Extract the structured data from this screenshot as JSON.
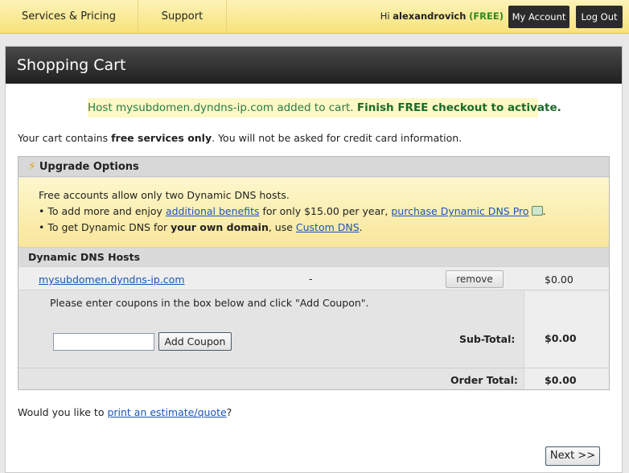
{
  "nav": {
    "services_label": "Services & Pricing",
    "support_label": "Support",
    "greeting_prefix": "Hi ",
    "username": "alexandrovich",
    "plan_badge": "(FREE)",
    "my_account_label": "My Account",
    "logout_label": "Log Out"
  },
  "page": {
    "title": "Shopping Cart"
  },
  "notice": {
    "text": "Host mysubdomen.dyndns-ip.com added to cart. ",
    "cta": "Finish FREE checkout to activate."
  },
  "cart_info": {
    "prefix": "Your cart contains ",
    "bold": "free services only",
    "suffix": ". You will not be asked for credit card information."
  },
  "upgrade": {
    "header": "Upgrade Options",
    "line1": "Free accounts allow only two Dynamic DNS hosts.",
    "line2_prefix": "• To add more and enjoy ",
    "line2_link1": "additional benefits",
    "line2_mid": " for only $15.00 per year, ",
    "line2_link2": "purchase Dynamic DNS Pro",
    "line2_suffix": ".",
    "line3_prefix": "• To get Dynamic DNS for ",
    "line3_bold": "your own domain",
    "line3_mid": ", use ",
    "line3_link": "Custom DNS",
    "line3_suffix": "."
  },
  "hosts": {
    "header": "Dynamic DNS Hosts",
    "items": [
      {
        "host": "mysubdomen.dyndns-ip.com",
        "detail": "-",
        "remove_label": "remove",
        "price": "$0.00"
      }
    ]
  },
  "coupon": {
    "message": "Please enter coupons in the box below and click \"Add Coupon\".",
    "input_value": "",
    "button_label": "Add Coupon"
  },
  "totals": {
    "subtotal_label": "Sub-Total:",
    "subtotal_value": "$0.00",
    "order_total_label": "Order Total:",
    "order_total_value": "$0.00"
  },
  "quote": {
    "prefix": "Would you like to ",
    "link": "print an estimate/quote",
    "suffix": "?"
  },
  "next_label": "Next >>",
  "colors": {
    "nav_bg": "#f7e27a",
    "title_bg": "#2b2b2b",
    "free_badge": "#2a8a1f",
    "link": "#1b55b8",
    "notice_text": "#2a7a4a"
  }
}
